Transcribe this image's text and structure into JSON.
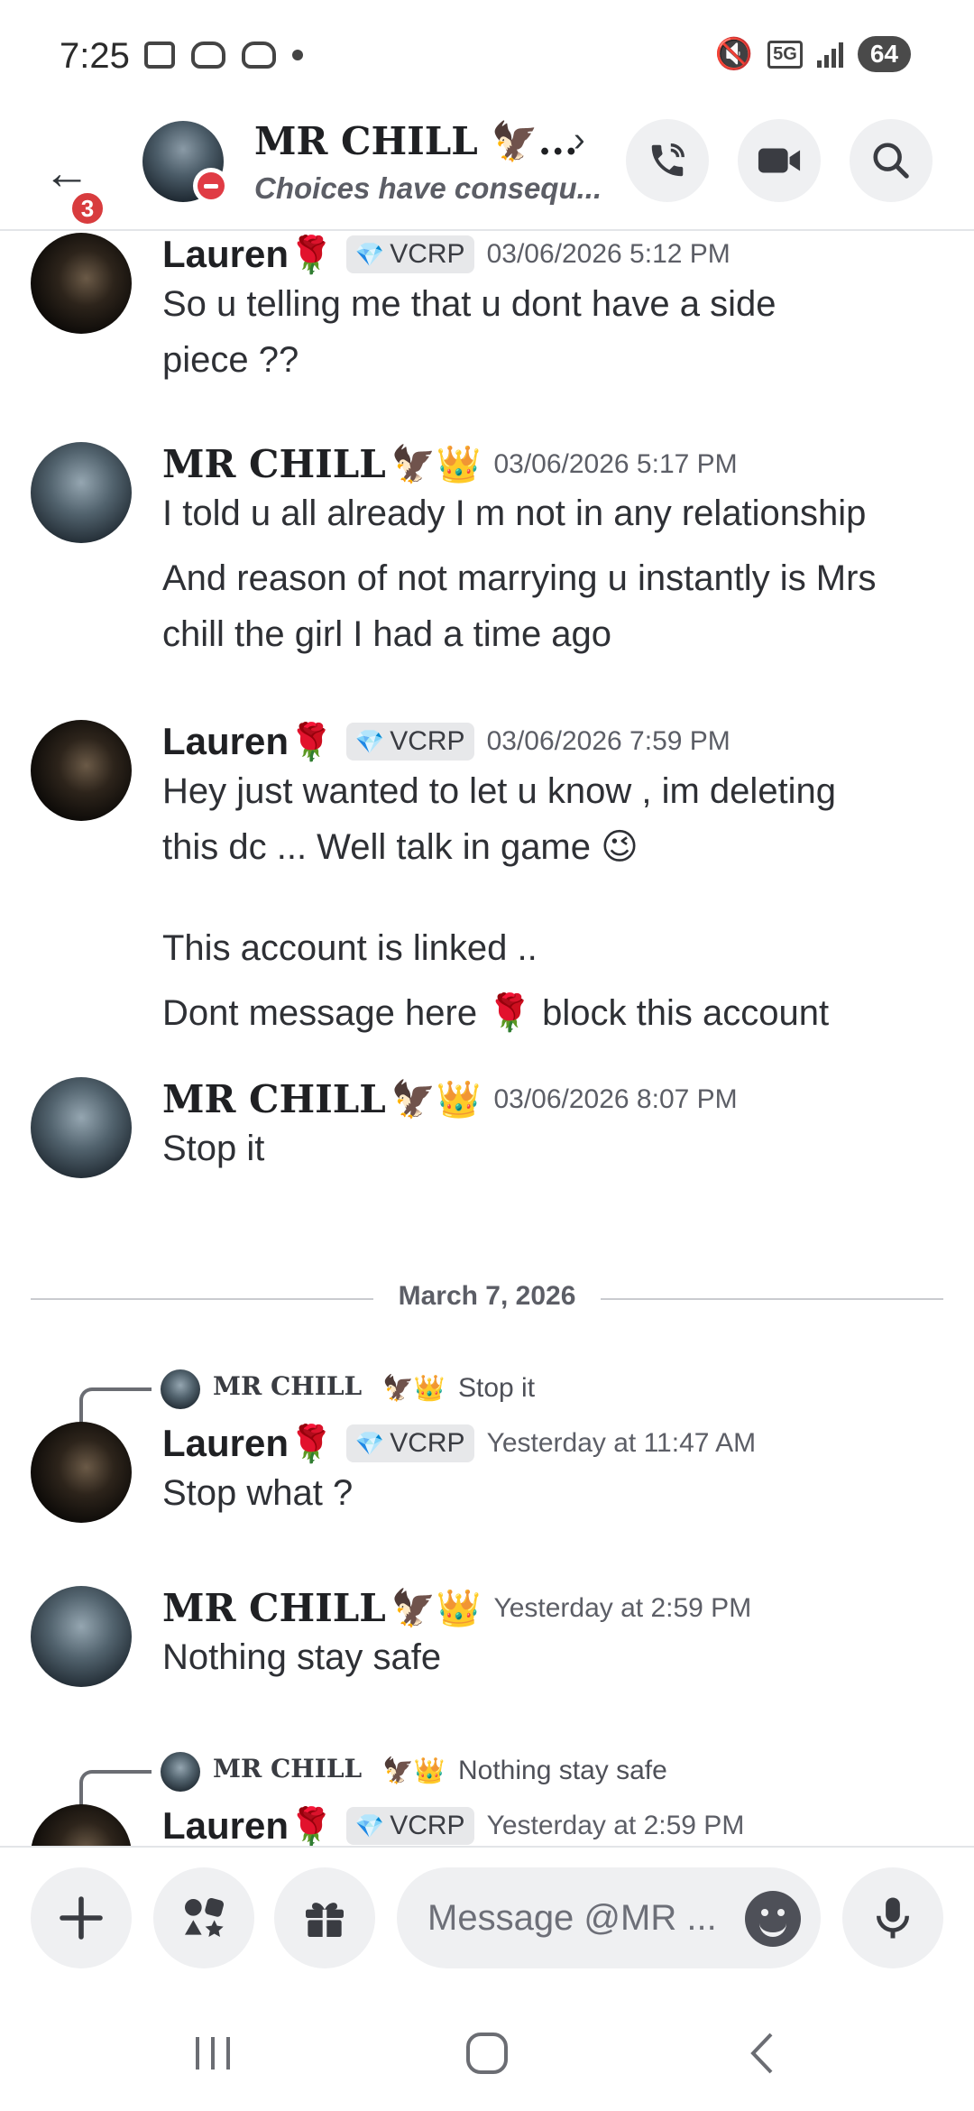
{
  "status_bar": {
    "time": "7:25",
    "network": "5G",
    "battery": "64"
  },
  "header": {
    "unread_count": "3",
    "title": "MR CHILL 🦅...",
    "subtitle": "Choices have consequ...",
    "status": "do-not-disturb"
  },
  "messages": [
    {
      "author": "Lauren",
      "author_emoji": "🌹",
      "tag": "VCRP",
      "timestamp": "03/06/2026 5:12 PM",
      "lines": [
        "So u telling me that u dont have a side",
        "piece ??"
      ]
    },
    {
      "author": "MR CHILL",
      "author_emoji": "🦅👑",
      "timestamp": "03/06/2026 5:17 PM",
      "lines": [
        "I told u all already I m not in any relationship",
        "And reason of not marrying u instantly is Mrs",
        "chill the girl I had a time ago"
      ]
    },
    {
      "author": "Lauren",
      "author_emoji": "🌹",
      "tag": "VCRP",
      "timestamp": "03/06/2026 7:59 PM",
      "lines": [
        "Hey just wanted to let u know , im deleting",
        "this dc ... Well talk in game 😉",
        "This account is linked ..",
        "Dont message here 🌹 block this account"
      ]
    },
    {
      "author": "MR CHILL",
      "author_emoji": "🦅👑",
      "timestamp": "03/06/2026 8:07 PM",
      "lines": [
        "Stop it"
      ]
    },
    {
      "reply_to": {
        "author": "MR CHILL",
        "author_emoji": "🦅👑",
        "text": "Stop it"
      },
      "author": "Lauren",
      "author_emoji": "🌹",
      "tag": "VCRP",
      "timestamp": "Yesterday at 11:47 AM",
      "lines": [
        "Stop what  ?"
      ]
    },
    {
      "author": "MR CHILL",
      "author_emoji": "🦅👑",
      "timestamp": "Yesterday at 2:59 PM",
      "lines": [
        "Nothing stay safe"
      ]
    },
    {
      "reply_to": {
        "author": "MR CHILL",
        "author_emoji": "🦅👑",
        "text": "Nothing stay safe"
      },
      "author": "Lauren",
      "author_emoji": "🌹",
      "tag": "VCRP",
      "timestamp": "Yesterday at 2:59 PM",
      "lines": []
    }
  ],
  "date_divider": "March 7, 2026",
  "composer": {
    "placeholder": "Message @MR ..."
  },
  "colors": {
    "badge": "#d83c3e",
    "dnd": "#e03b44",
    "tag_gem": "#e0761e"
  }
}
